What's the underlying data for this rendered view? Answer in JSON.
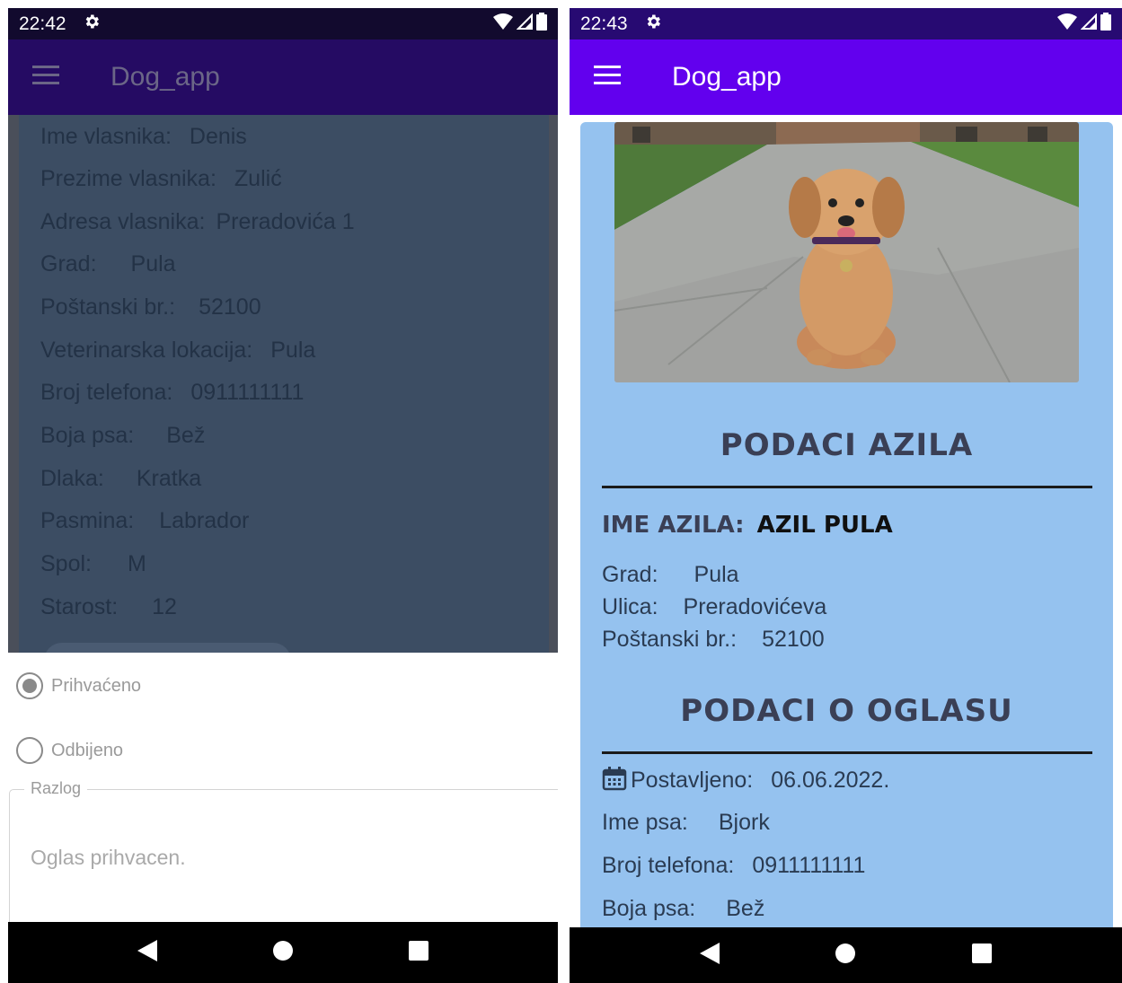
{
  "left_screen": {
    "status": {
      "time": "22:42"
    },
    "app_title": "Dog_app",
    "details": [
      {
        "label": "Ime vlasnika:",
        "value": "Denis"
      },
      {
        "label": "Prezime vlasnika:",
        "value": "Zulić"
      },
      {
        "label": "Adresa vlasnika:",
        "value": "Preradovića 1"
      },
      {
        "label": "Grad:",
        "value": "Pula"
      },
      {
        "label": "Poštanski br.:",
        "value": "52100"
      },
      {
        "label": "Veterinarska lokacija:",
        "value": "Pula"
      },
      {
        "label": "Broj telefona:",
        "value": "0911111111"
      },
      {
        "label": "Boja psa:",
        "value": "Bež"
      },
      {
        "label": "Dlaka:",
        "value": "Kratka"
      },
      {
        "label": "Pasmina:",
        "value": "Labrador"
      },
      {
        "label": "Spol:",
        "value": "M"
      },
      {
        "label": "Starost:",
        "value": "12"
      }
    ],
    "dialog": {
      "option_accepted": "Prihvaćeno",
      "option_rejected": "Odbijeno",
      "selected": "Prihvaćeno",
      "reason_label": "Razlog",
      "reason_value": "Oglas prihvacen."
    }
  },
  "right_screen": {
    "status": {
      "time": "22:43"
    },
    "app_title": "Dog_app",
    "shelter_section_title": "Podaci azila",
    "shelter_name_label": "Ime azila:",
    "shelter_name_value": "Azil Pula",
    "shelter_details": [
      {
        "label": "Grad:",
        "value": "Pula"
      },
      {
        "label": "Ulica:",
        "value": "Preradovićeva"
      },
      {
        "label": "Poštanski br.:",
        "value": "52100"
      }
    ],
    "ad_section_title": "Podaci o oglasu",
    "ad_details": [
      {
        "label": "Postavljeno:",
        "value": "06.06.2022."
      },
      {
        "label": "Ime psa:",
        "value": "Bjork"
      },
      {
        "label": "Broj telefona:",
        "value": "0911111111"
      },
      {
        "label": "Boja psa:",
        "value": "Bež"
      }
    ]
  },
  "colors": {
    "appbar_active": "#6200ee",
    "appbar_dimmed": "#250b63",
    "card_blue": "#95c2ef",
    "scrim_card": "#3c4d63"
  },
  "icons": [
    "gear-icon",
    "wifi-icon",
    "signal-icon",
    "battery-icon",
    "menu-icon",
    "back-icon",
    "home-icon",
    "recents-icon",
    "calendar-icon"
  ]
}
